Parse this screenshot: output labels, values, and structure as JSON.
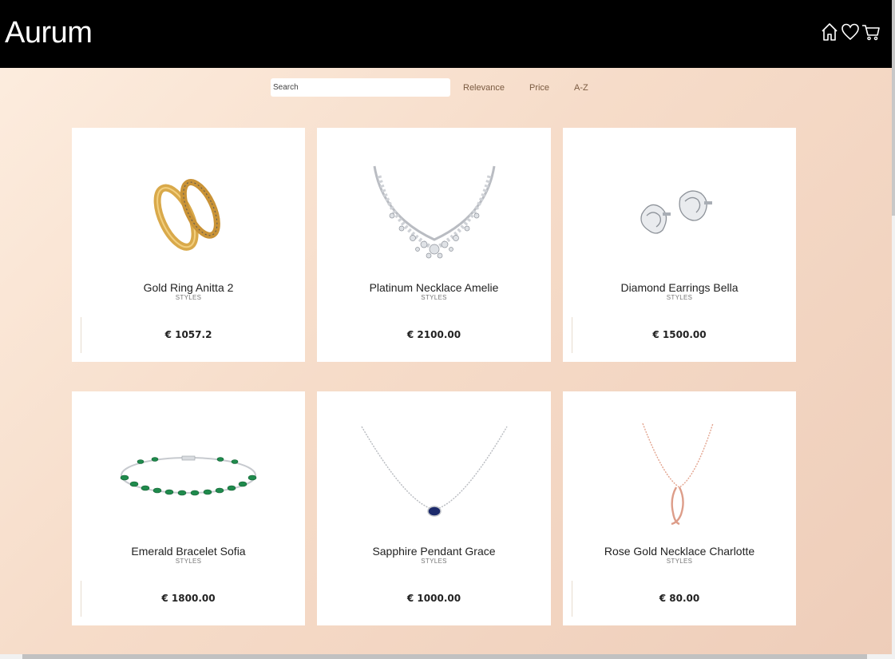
{
  "header": {
    "logo": "Aurum",
    "icons": [
      "home-icon",
      "heart-icon",
      "cart-icon"
    ]
  },
  "toolbar": {
    "search_placeholder": "Search",
    "sort_relevance": "Relevance",
    "sort_price": "Price",
    "sort_az": "A-Z"
  },
  "products": [
    {
      "name": "Gold Ring Anitta 2",
      "category": "STYLES",
      "price": "€ 1057.2",
      "image": "gold-rings"
    },
    {
      "name": "Platinum Necklace Amelie",
      "category": "STYLES",
      "price": "€ 2100.00",
      "image": "diamond-necklace"
    },
    {
      "name": "Diamond Earrings Bella",
      "category": "STYLES",
      "price": "€ 1500.00",
      "image": "diamond-earrings"
    },
    {
      "name": "Emerald Bracelet Sofia",
      "category": "STYLES",
      "price": "€ 1800.00",
      "image": "emerald-bracelet"
    },
    {
      "name": "Sapphire Pendant Grace",
      "category": "STYLES",
      "price": "€ 1000.00",
      "image": "sapphire-pendant"
    },
    {
      "name": "Rose Gold Necklace Charlotte",
      "category": "STYLES",
      "price": "€ 80.00",
      "image": "rose-gold-necklace"
    }
  ],
  "colors": {
    "header_bg": "#000000",
    "sort_text": "#7a5a40",
    "gold": "#d9a94a",
    "emerald": "#1f8a4c",
    "sapphire": "#1c2a6b",
    "rose_gold": "#e3a48f"
  }
}
